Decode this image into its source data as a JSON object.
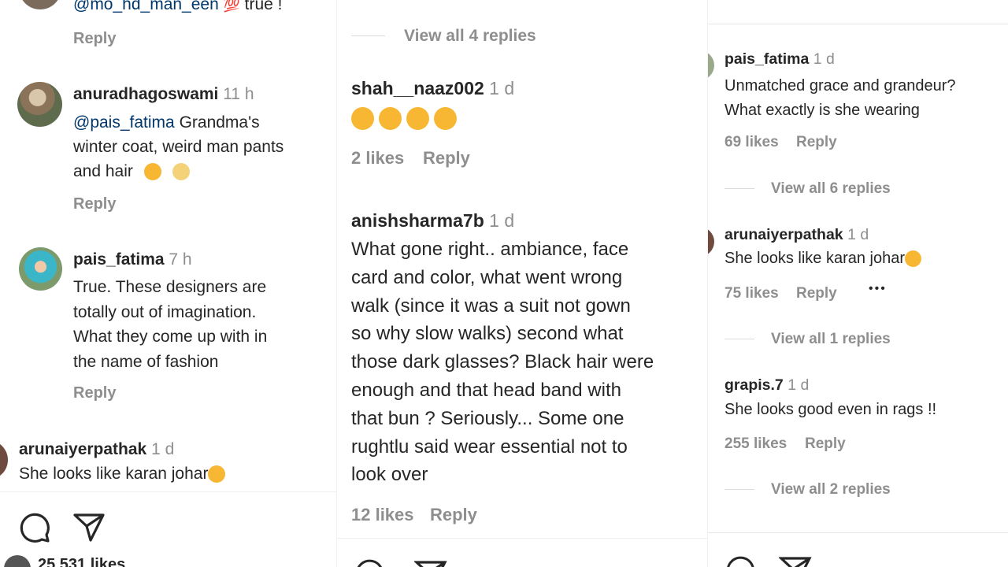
{
  "p1": {
    "top": {
      "username": "@mo_hd_man_een",
      "emoji": "💯",
      "text": "true !",
      "reply": "Reply"
    },
    "c1": {
      "username": "anuradhagoswami",
      "time": "11 h",
      "mention": "@pais_fatima",
      "line1": "Grandma's",
      "line2": "winter coat, weird man pants",
      "line3": "and hair",
      "reply": "Reply"
    },
    "c2": {
      "username": "pais_fatima",
      "time": "7 h",
      "lines": [
        "True. These designers are",
        "totally out of imagination.",
        "What they come up with in",
        "the name of fashion"
      ],
      "reply": "Reply"
    },
    "c3": {
      "username": "arunaiyerpathak",
      "time": "1 d",
      "text": "She looks like karan johar"
    },
    "likes": "25,531 likes"
  },
  "p2": {
    "view_replies": "View all 4 replies",
    "c1": {
      "username": "shah__naaz002",
      "time": "1 d",
      "likes": "2 likes",
      "reply": "Reply"
    },
    "c2": {
      "username": "anishsharma7b",
      "time": "1 d",
      "lines": [
        "What gone right.. ambiance, face",
        "card and color, what went wrong",
        "walk (since it was a suit not gown",
        "so why slow walks) second what",
        "those dark glasses? Black hair were",
        "enough and that head band with",
        "that bun ? Seriously... Some one",
        "rughtlu said wear essential not to",
        "look over"
      ],
      "likes": "12 likes",
      "reply": "Reply"
    }
  },
  "p3": {
    "c1": {
      "username": "pais_fatima",
      "time": "1 d",
      "lines": [
        "Unmatched grace and grandeur?",
        "What exactly is she wearing"
      ],
      "likes": "69 likes",
      "reply": "Reply",
      "view_replies": "View all 6 replies"
    },
    "c2": {
      "username": "arunaiyerpathak",
      "time": "1 d",
      "text": "She looks like karan johar",
      "likes": "75 likes",
      "reply": "Reply",
      "more": "•••",
      "view_replies": "View all 1 replies"
    },
    "c3": {
      "username": "grapis.7",
      "time": "1 d",
      "text": "She looks good even in rags !!",
      "likes": "255 likes",
      "reply": "Reply",
      "view_replies": "View all 2 replies"
    }
  },
  "icons": [
    "comment-icon",
    "share-icon",
    "laughing-emoji-icon",
    "heart-eyes-emoji-icon",
    "hundred-emoji-icon"
  ]
}
